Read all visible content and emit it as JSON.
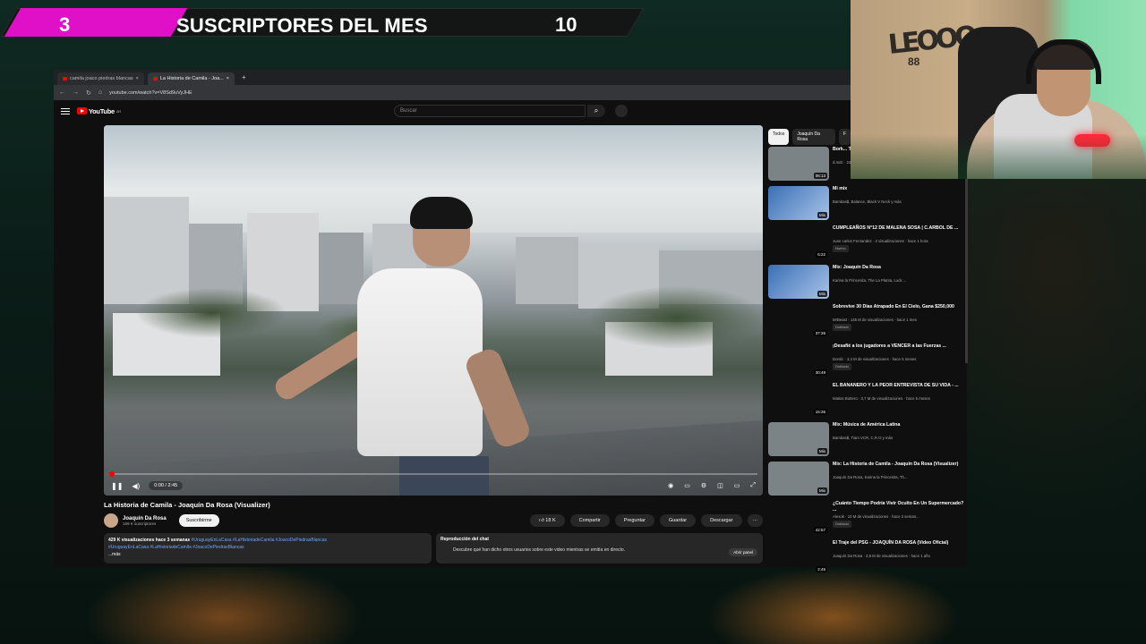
{
  "banner": {
    "left_count": "3",
    "title": "SUSCRIPTORES DEL MES",
    "right_count": "10",
    "accent": "#e010c8"
  },
  "browser": {
    "tabs": [
      {
        "label": "camila joaco piedras blancas"
      },
      {
        "label": "La Historia de Camila - Joa..."
      }
    ],
    "new_tab": "+",
    "url": "youtube.com/watch?v=V8Sd9uVyJHE"
  },
  "youtube": {
    "logo": "YouTube",
    "logo_country": "AR",
    "search_placeholder": "Buscar",
    "video": {
      "time": "0:00 / 2:45",
      "progress_fraction": 0.0,
      "title": "La Historia de Camila - Joaquín Da Rosa (Visualizer)",
      "channel": "Joaquín Da Rosa",
      "subscribers": "169 K suscriptores",
      "subscribe_label": "Suscribirme",
      "actions": {
        "like": "18 K",
        "share": "Compartir",
        "ask": "Preguntar",
        "save": "Guardar",
        "download": "Descargar",
        "more": "···"
      },
      "description": {
        "stats": "429 K visualizaciones  hace 3 semanas",
        "hashtags_1": "#UruguayEnLaCasa #LaHistoriadeCamila #JoacoDePiedrasBlancas",
        "hashtags_2": "#UruguayEnLaCasa #LaHistoriadeCamila #JoacoDePiedrasBlancas",
        "more": "...más"
      },
      "chat": {
        "title": "Reproducción del chat",
        "text": "Descubre qué han dicho otros usuarios sobre este video mientras se emitía en directo.",
        "button": "Abrir panel"
      }
    },
    "chips": [
      "Todos",
      "Joaquín Da Rosa",
      "F"
    ],
    "recommendations": [
      {
        "title": "Bork... Tech Mi...",
        "meta": "d.mdc · 249 K vis...",
        "duration": "06:13",
        "badge": "",
        "thumb": "gray"
      },
      {
        "title": "Mi mix",
        "meta": "Bambas$, Balance, Black V Neck y más",
        "duration": "Mix",
        "badge": "",
        "thumb": "mix"
      },
      {
        "title": "CUMPLEAÑOS N°12 DE MALENA SOSA | C.ARBOL DE ...",
        "meta": "Juan carlos Fernandez · 2 visualizaciones · hace 1 hora",
        "duration": "6:22",
        "badge": "Nuevo",
        "thumb": "empty"
      },
      {
        "title": "Mix: Joaquín Da Rosa",
        "meta": "Karina la Princesita, The La Planta, Luck ...",
        "duration": "Mix",
        "badge": "",
        "thumb": "mix"
      },
      {
        "title": "Sobrevive 30 Días Atrapado En El Cielo, Gana $250,000",
        "meta": "MrBeast · 145 M de visualizaciones · hace 1 mes",
        "duration": "37:26",
        "badge": "Doblado",
        "thumb": "empty"
      },
      {
        "title": "¡Desafié a los jugadores a VENCER a las Fuerzas ...",
        "meta": "Dontic · 3,4 M de visualizaciones · hace 5 meses",
        "duration": "30:49",
        "badge": "Doblado",
        "thumb": "empty"
      },
      {
        "title": "EL BANANERO Y LA PEOR ENTREVISTA DE SU VIDA - ...",
        "meta": "Matias Bottero · 3,7 M de visualizaciones · hace 5 meses",
        "duration": "15:26",
        "badge": "",
        "thumb": "empty"
      },
      {
        "title": "Mix: Música de América Latina",
        "meta": "Bambas$, Tiam VCR, C.R.O y más",
        "duration": "Mix",
        "badge": "",
        "thumb": "gray"
      },
      {
        "title": "Mix: La Historia de Camila - Joaquín Da Rosa (Visualizer)",
        "meta": "Joaquín Da Rosa, Karina la Princesita, Th...",
        "duration": "Mix",
        "badge": "",
        "thumb": "gray"
      },
      {
        "title": "¿Cuánto Tiempo Podría Vivir Oculto En Un Supermercado? ...",
        "meta": "Alexok · 10 M de visualizaciones · hace 3 seman...",
        "duration": "42:57",
        "badge": "Doblado",
        "thumb": "empty"
      },
      {
        "title": "El Traje del PSG - JOAQUÍN DA ROSA (Video Oficial)",
        "meta": "Joaquín Da Rosa · 2,8 M de visualizaciones · hace 1 año",
        "duration": "2:45",
        "badge": "",
        "thumb": "empty"
      }
    ]
  },
  "webcam": {
    "wall_logo": "LEOOO",
    "wall_logo_sub": "88"
  }
}
